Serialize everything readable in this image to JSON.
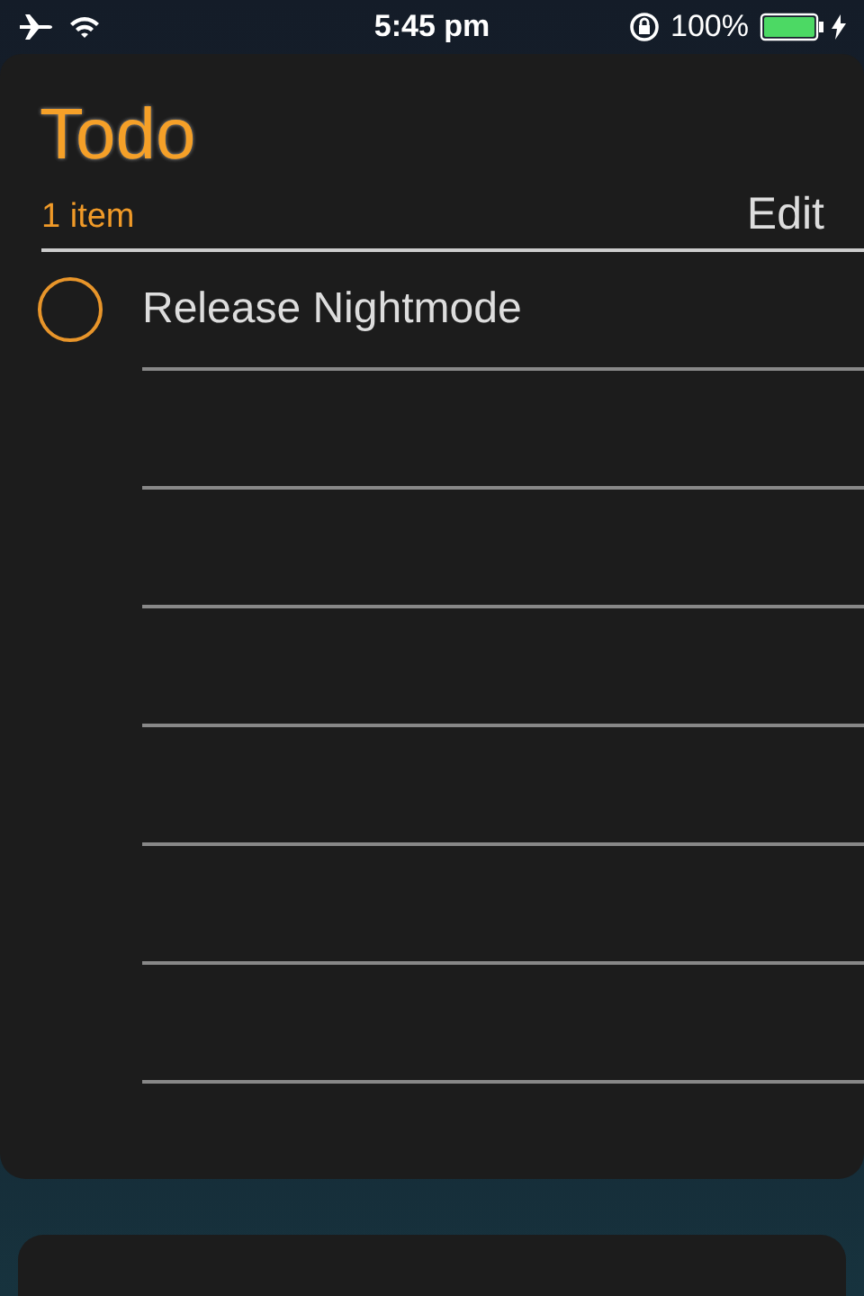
{
  "status_bar": {
    "time": "5:45 pm",
    "battery_percent": "100%"
  },
  "list": {
    "title": "Todo",
    "count": "1 item",
    "edit_button": "Edit",
    "items": [
      {
        "text": "Release Nightmode",
        "checked": false
      }
    ]
  }
}
